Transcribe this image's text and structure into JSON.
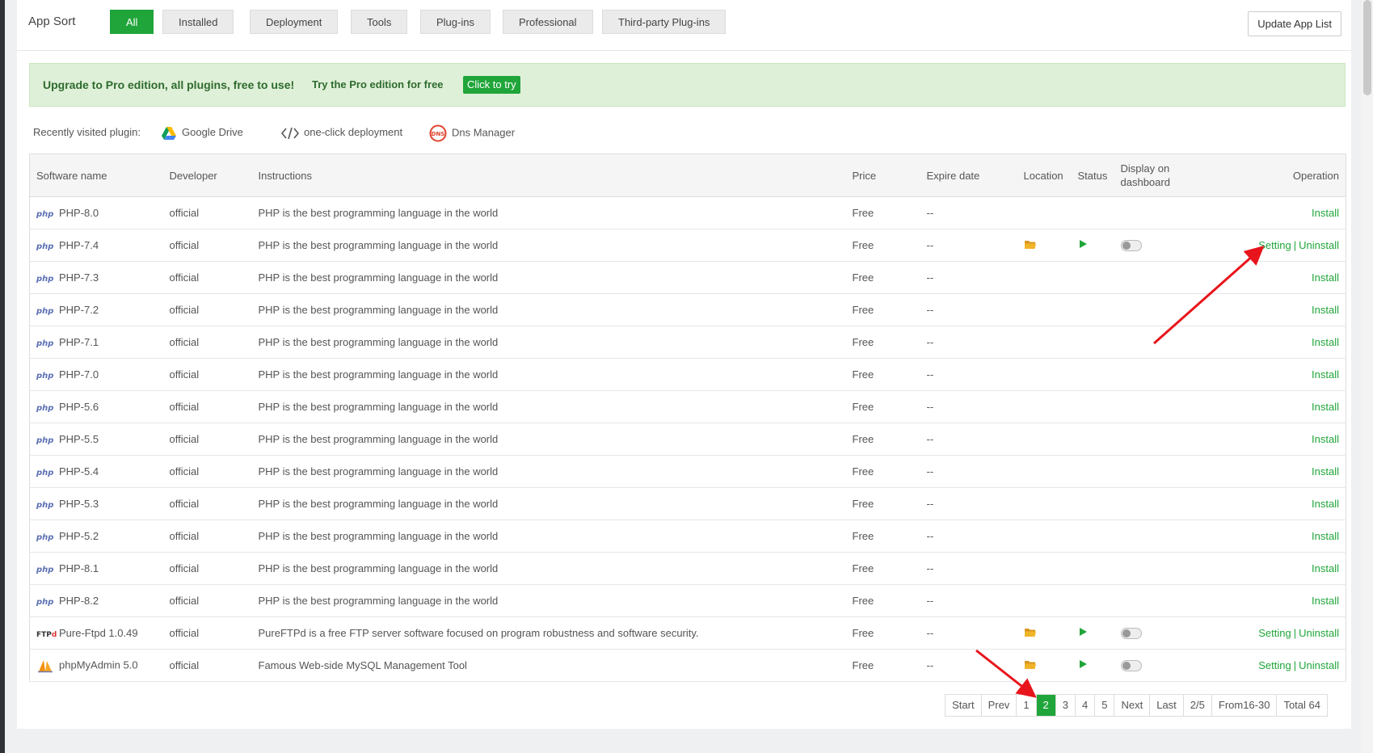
{
  "sort_bar": {
    "label": "App Sort",
    "tabs": [
      "All",
      "Installed",
      "Deployment",
      "Tools",
      "Plug-ins",
      "Professional",
      "Third-party Plug-ins"
    ],
    "active_tab": "All",
    "update_button": "Update App List"
  },
  "promo": {
    "text": "Upgrade to Pro edition, all plugins, free to use!",
    "try_text": "Try the Pro edition for free",
    "button": "Click to try"
  },
  "recent": {
    "label": "Recently visited plugin:",
    "items": [
      {
        "name": "Google Drive",
        "icon": "google-drive-icon"
      },
      {
        "name": "one-click deployment",
        "icon": "code-icon"
      },
      {
        "name": "Dns Manager",
        "icon": "dns-icon"
      }
    ]
  },
  "table": {
    "headers": {
      "name": "Software name",
      "developer": "Developer",
      "instructions": "Instructions",
      "price": "Price",
      "expire": "Expire date",
      "location": "Location",
      "status": "Status",
      "dashboard": "Display on dashboard",
      "operation": "Operation"
    },
    "rows": [
      {
        "name": "PHP-8.0",
        "icon": "php",
        "developer": "official",
        "instructions": "PHP is the best programming language in the world",
        "price": "Free",
        "expire": "--",
        "installed": false,
        "op": "Install"
      },
      {
        "name": "PHP-7.4",
        "icon": "php",
        "developer": "official",
        "instructions": "PHP is the best programming language in the world",
        "price": "Free",
        "expire": "--",
        "installed": true,
        "setting": "Setting",
        "uninstall": "Uninstall"
      },
      {
        "name": "PHP-7.3",
        "icon": "php",
        "developer": "official",
        "instructions": "PHP is the best programming language in the world",
        "price": "Free",
        "expire": "--",
        "installed": false,
        "op": "Install"
      },
      {
        "name": "PHP-7.2",
        "icon": "php",
        "developer": "official",
        "instructions": "PHP is the best programming language in the world",
        "price": "Free",
        "expire": "--",
        "installed": false,
        "op": "Install"
      },
      {
        "name": "PHP-7.1",
        "icon": "php",
        "developer": "official",
        "instructions": "PHP is the best programming language in the world",
        "price": "Free",
        "expire": "--",
        "installed": false,
        "op": "Install"
      },
      {
        "name": "PHP-7.0",
        "icon": "php",
        "developer": "official",
        "instructions": "PHP is the best programming language in the world",
        "price": "Free",
        "expire": "--",
        "installed": false,
        "op": "Install"
      },
      {
        "name": "PHP-5.6",
        "icon": "php",
        "developer": "official",
        "instructions": "PHP is the best programming language in the world",
        "price": "Free",
        "expire": "--",
        "installed": false,
        "op": "Install"
      },
      {
        "name": "PHP-5.5",
        "icon": "php",
        "developer": "official",
        "instructions": "PHP is the best programming language in the world",
        "price": "Free",
        "expire": "--",
        "installed": false,
        "op": "Install"
      },
      {
        "name": "PHP-5.4",
        "icon": "php",
        "developer": "official",
        "instructions": "PHP is the best programming language in the world",
        "price": "Free",
        "expire": "--",
        "installed": false,
        "op": "Install"
      },
      {
        "name": "PHP-5.3",
        "icon": "php",
        "developer": "official",
        "instructions": "PHP is the best programming language in the world",
        "price": "Free",
        "expire": "--",
        "installed": false,
        "op": "Install"
      },
      {
        "name": "PHP-5.2",
        "icon": "php",
        "developer": "official",
        "instructions": "PHP is the best programming language in the world",
        "price": "Free",
        "expire": "--",
        "installed": false,
        "op": "Install"
      },
      {
        "name": "PHP-8.1",
        "icon": "php",
        "developer": "official",
        "instructions": "PHP is the best programming language in the world",
        "price": "Free",
        "expire": "--",
        "installed": false,
        "op": "Install"
      },
      {
        "name": "PHP-8.2",
        "icon": "php",
        "developer": "official",
        "instructions": "PHP is the best programming language in the world",
        "price": "Free",
        "expire": "--",
        "installed": false,
        "op": "Install"
      },
      {
        "name": "Pure-Ftpd 1.0.49",
        "icon": "ftp",
        "developer": "official",
        "instructions": "PureFTPd is a free FTP server software focused on program robustness and software security.",
        "price": "Free",
        "expire": "--",
        "installed": true,
        "setting": "Setting",
        "uninstall": "Uninstall"
      },
      {
        "name": "phpMyAdmin 5.0",
        "icon": "pma",
        "developer": "official",
        "instructions": "Famous Web-side MySQL Management Tool",
        "price": "Free",
        "expire": "--",
        "installed": true,
        "setting": "Setting",
        "uninstall": "Uninstall"
      }
    ]
  },
  "pagination": {
    "start": "Start",
    "prev": "Prev",
    "pages": [
      "1",
      "2",
      "3",
      "4",
      "5"
    ],
    "current": "2",
    "next": "Next",
    "last": "Last",
    "page_info": "2/5",
    "range": "From16-30",
    "total": "Total 64"
  },
  "colors": {
    "accent": "#20a53a",
    "promo_bg": "#dff0d8",
    "annotation_arrow": "#e8141b",
    "folder": "#f0b429"
  }
}
